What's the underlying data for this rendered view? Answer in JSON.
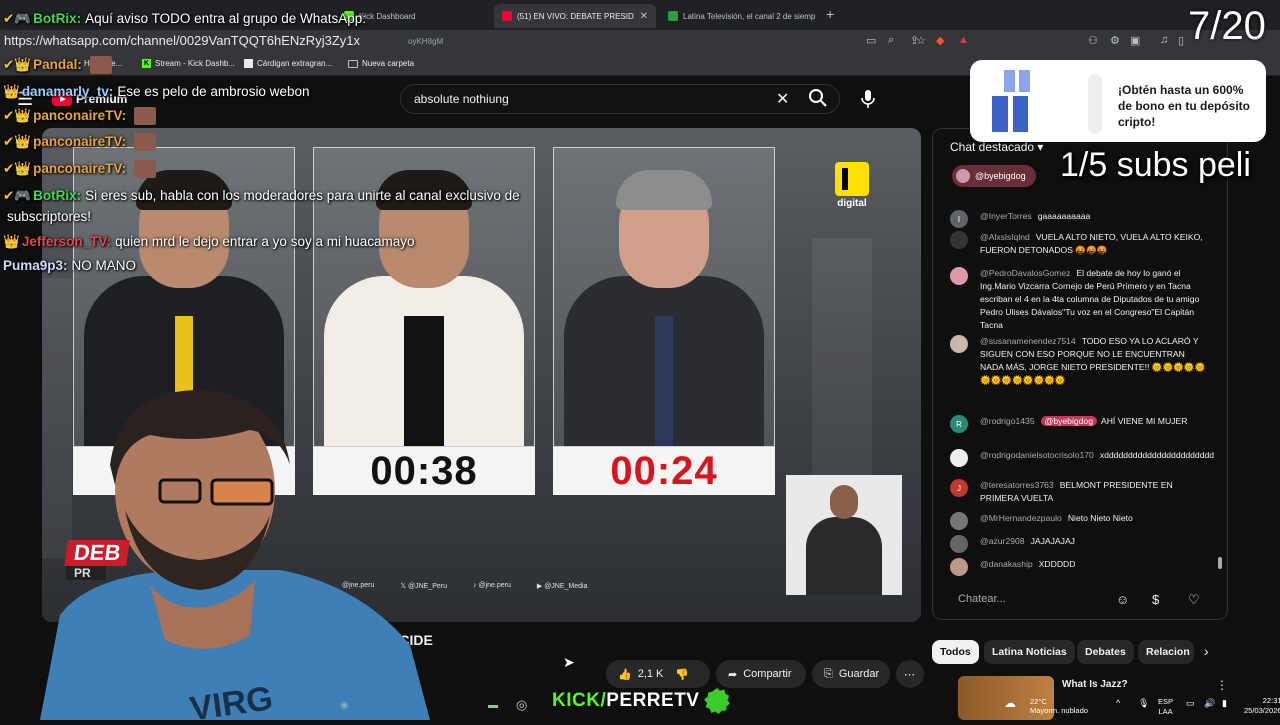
{
  "browser": {
    "tabs": [
      {
        "label": "Kick Dashboard",
        "active": false
      },
      {
        "label": "(51) EN VIVO: DEBATE PRESID",
        "active": true
      },
      {
        "label": "Latina Televisión, el canal 2 de siemp",
        "active": false
      }
    ],
    "url": "https://whatsapp.com/channel/0029VanTQQT6hENzRyj3Zy1x",
    "url_rest": "oyKH8gM",
    "bookmarks": [
      "Hojas de...",
      "Stream - Kick Dashb...",
      "Cárdigan extragran...",
      "Nueva carpeta"
    ]
  },
  "youtube": {
    "logo_label": "Premium",
    "search_query": "absolute nothiung",
    "video_title_fragment": "ECIDE",
    "actions": {
      "likes": "2,1 K",
      "share": "Compartir",
      "save": "Guardar"
    },
    "timers": {
      "left": "00:38",
      "right": "00:24"
    },
    "channel_logo": "digital",
    "socials": [
      "@jne.peru",
      "@JNE_Peru",
      "@jne.peru",
      "@JNE_Media"
    ],
    "colors": {
      "timer_right": "#d8141f",
      "timer_left": "#111111",
      "accent": "#ff0033"
    }
  },
  "chat": {
    "header": "Chat destacado",
    "pinned_user": "@byebigdog",
    "messages": [
      {
        "user": "@InyerTorres",
        "text": "gaaaaaaaaaa",
        "avatar_color": "#5f6368",
        "initial": "I"
      },
      {
        "user": "@AlxslsIqlnd",
        "text": "VUELA ALTO NIETO, VUELA ALTO KEIKO, FUERON DETONADOS 🤬🤬🤬",
        "avatar_color": "#333",
        "initial": ""
      },
      {
        "user": "@PedroDavalosGomez",
        "text": "El debate de hoy lo ganó el Ing.Mario Vizcarra Cornejo de Perú Primero y en Tacna escriban el 4 en la 4ta columna de Diputados de tu amigo Pedro Ulises Dávalos\"Tu voz en el Congreso\"El Capitán Tacna",
        "avatar_color": "#d9a",
        "initial": ""
      },
      {
        "user": "@susanamenendez7514",
        "text": "TODO ESO YA LO ACLARÓ Y SIGUEN CON ESO PORQUE NO LE ENCUENTRAN NADA MÁS, JORGE NIETO PRESIDENTE!! 🌞🌞🌞🌞🌞🌞🌞🌞🌞🌞🌞🌞🌞",
        "avatar_color": "#c8b8a8",
        "initial": ""
      },
      {
        "user": "@rodrigo1435",
        "mention": "@byebigdog",
        "text": "AHÍ VIENE MI MUJER",
        "avatar_color": "#2a8a7a",
        "initial": "R"
      },
      {
        "user": "@rodrigodanielsotocrisolo170",
        "text": "xddddddddddddddddddddddd",
        "avatar_color": "#eee",
        "initial": ""
      },
      {
        "user": "@teresatorres3763",
        "text": "BELMONT PRESIDENTE EN PRIMERA VUELTA",
        "avatar_color": "#c0392b",
        "initial": "J"
      },
      {
        "user": "@MrHernandezpaulo",
        "text": "Nieto Nieto Nieto",
        "avatar_color": "#777",
        "initial": ""
      },
      {
        "user": "@azur2908",
        "text": "JAJAJAJAJ",
        "avatar_color": "#666",
        "initial": ""
      },
      {
        "user": "@danakaship",
        "text": "XDDDDD",
        "avatar_color": "#b98",
        "initial": ""
      }
    ],
    "input_placeholder": "Chatear...",
    "chips": [
      "Todos",
      "Latina Noticias",
      "Debates",
      "Relacion"
    ],
    "next_video_title": "What Is Jazz?"
  },
  "overlay_chat": [
    {
      "icons": "✔🎮",
      "name": "BotRix:",
      "name_color": "#3ddc4a",
      "text": "Aquí aviso TODO entra al grupo de WhatsApp:"
    },
    {
      "icons": "",
      "name": "",
      "name_color": "#fff",
      "text": ""
    },
    {
      "icons": "✔👑",
      "name": "Pandal:",
      "name_color": "#e8a33a",
      "text": ""
    },
    {
      "icons": "👑",
      "name": "danamarly_tv:",
      "name_color": "#9ad0ff",
      "text": "Ese es pelo de ambrosio webon"
    },
    {
      "icons": "✔👑",
      "name": "panconaireTV:",
      "name_color": "#e8a33a",
      "text": ""
    },
    {
      "icons": "✔👑",
      "name": "panconaireTV:",
      "name_color": "#e8a33a",
      "text": ""
    },
    {
      "icons": "✔👑",
      "name": "panconaireTV:",
      "name_color": "#e8a33a",
      "text": ""
    },
    {
      "icons": "✔🎮",
      "name": "BotRix:",
      "name_color": "#3ddc4a",
      "text": "Si eres sub, habla con los moderadores para unirte al canal exclusivo de"
    },
    {
      "icons": "",
      "name": "",
      "name_color": "#fff",
      "text": "subscriptores!"
    },
    {
      "icons": "👑",
      "name": "Jefferson_TV:",
      "name_color": "#e0464b",
      "text": "quien mrd le dejo entrar a yo soy a mi huacamayo"
    },
    {
      "icons": "",
      "name": "Puma9p3:",
      "name_color": "#cfd8ff",
      "text": "NO MANO"
    }
  ],
  "stream_overlay": {
    "counter": "7/20",
    "subs_goal": "1/5 subs peli",
    "ad_text": "¡Obtén hasta un 600% de bono en tu depósito cripto!",
    "brand_kick": "KICK/",
    "brand_name": "PERRETV",
    "badge_label": "DEB",
    "badge_sub": "PR"
  },
  "taskbar": {
    "weather_temp": "22°C",
    "weather_desc": "Mayorm. nublado",
    "lang_1": "ESP",
    "lang_2": "LAA",
    "time": "22:31",
    "date": "25/03/2026"
  }
}
